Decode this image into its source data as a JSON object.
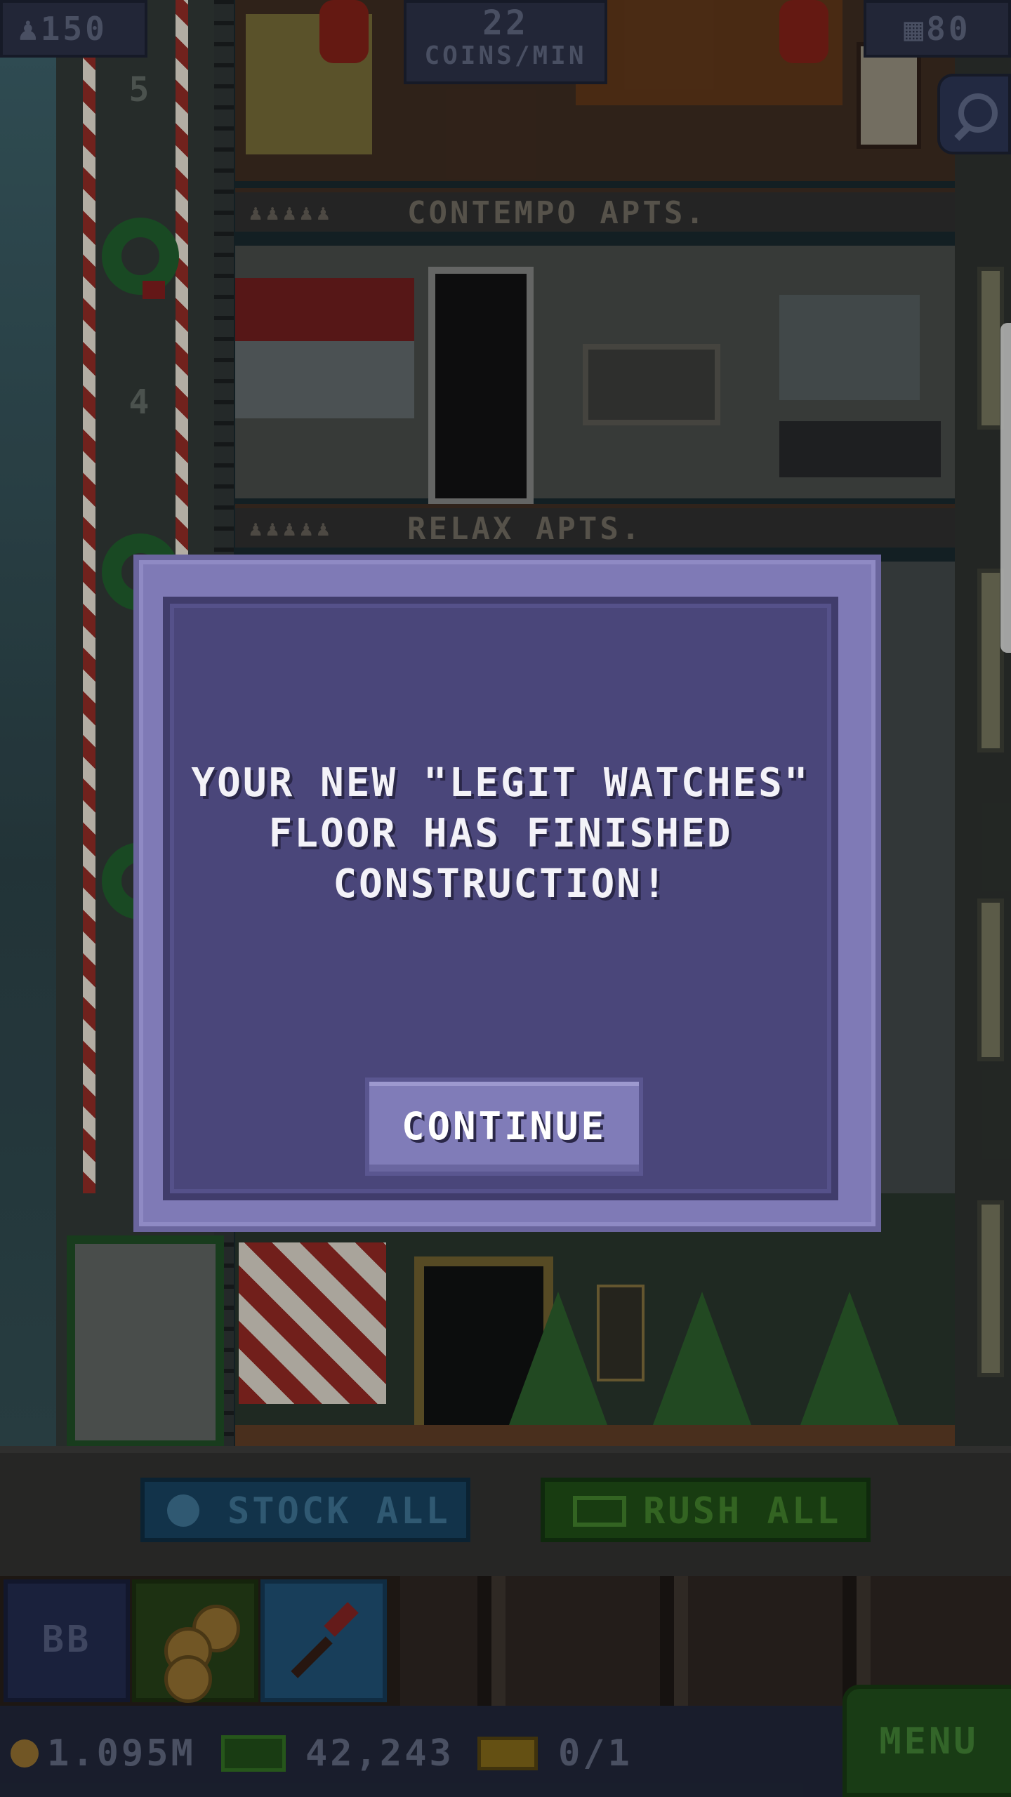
{
  "hud": {
    "population": "150",
    "coins_rate_value": "22",
    "coins_rate_unit": "COINS/MIN",
    "floors": "80",
    "population_icon": "person-icon",
    "floors_icon": "building-icon",
    "search_icon": "magnifier-icon"
  },
  "tower": {
    "floors": [
      {
        "number": "5",
        "label": "CONTEMPO APTS.",
        "people": "♟♟♟♟♟"
      },
      {
        "number": "4",
        "label": "RELAX APTS.",
        "people": "♟♟♟♟♟"
      }
    ]
  },
  "dialog": {
    "message_line1": "YOUR NEW \"LEGIT WATCHES\"",
    "message_line2": "FLOOR HAS FINISHED",
    "message_line3": "CONSTRUCTION!",
    "continue_label": "CONTINUE"
  },
  "actions": {
    "stock_all_label": "STOCK ALL",
    "rush_all_label": "RUSH ALL"
  },
  "tabs": {
    "bb_label": "BB",
    "coins_icon": "coins-icon",
    "build_icon": "pickaxe-icon"
  },
  "status": {
    "coins": "1.095M",
    "bux": "42,243",
    "vip_tickets": "0/1",
    "menu_label": "MENU"
  },
  "colors": {
    "dialog_outer": "#7f7ab6",
    "dialog_inner": "#4a467a",
    "stock_all": "#173f5b",
    "rush_all": "#1e4a15",
    "menu": "#1f4a1a"
  }
}
